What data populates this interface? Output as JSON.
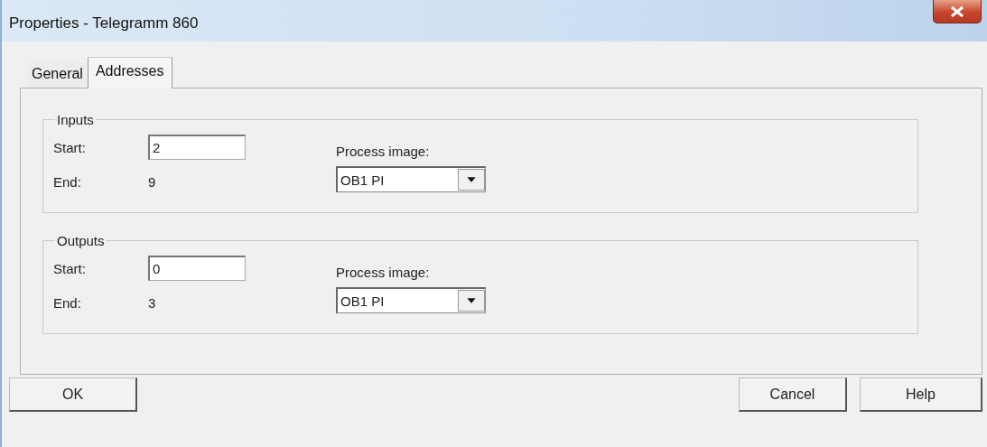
{
  "window": {
    "title": "Properties - Telegramm 860"
  },
  "tabs": [
    {
      "label": "General",
      "selected": false
    },
    {
      "label": "Addresses",
      "selected": true
    }
  ],
  "groups": [
    {
      "title": "Inputs",
      "start_label": "Start:",
      "start_value": "2",
      "end_label": "End:",
      "end_value": "9",
      "process_image_label": "Process image:",
      "process_image_value": "OB1 PI"
    },
    {
      "title": "Outputs",
      "start_label": "Start:",
      "start_value": "0",
      "end_label": "End:",
      "end_value": "3",
      "process_image_label": "Process image:",
      "process_image_value": "OB1 PI"
    }
  ],
  "buttons": {
    "left": [
      "OK"
    ],
    "right": [
      "Cancel",
      "Help"
    ]
  }
}
